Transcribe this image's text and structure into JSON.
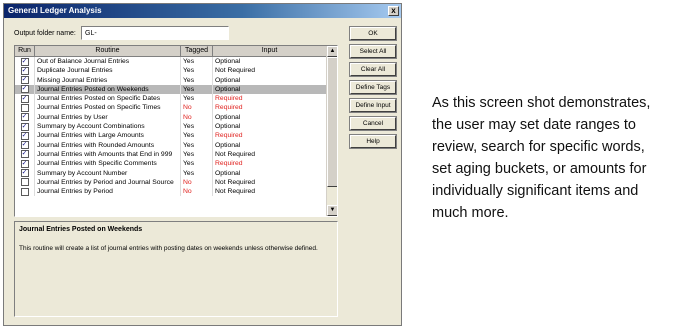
{
  "window": {
    "title": "General Ledger Analysis",
    "close_glyph": "x"
  },
  "output": {
    "label": "Output folder name:",
    "value": "GL-"
  },
  "grid": {
    "columns": [
      "Run",
      "Routine",
      "Tagged",
      "Input"
    ],
    "rows": [
      {
        "run": true,
        "routine": "Out of Balance Journal Entries",
        "tagged": "Yes",
        "input": "Optional",
        "tagged_red": false,
        "input_red": false
      },
      {
        "run": true,
        "routine": "Duplicate Journal Entries",
        "tagged": "Yes",
        "input": "Not Required",
        "tagged_red": false,
        "input_red": false
      },
      {
        "run": true,
        "routine": "Missing Journal Entries",
        "tagged": "Yes",
        "input": "Optional",
        "tagged_red": false,
        "input_red": false
      },
      {
        "run": true,
        "routine": "Journal Entries Posted on Weekends",
        "tagged": "Yes",
        "input": "Optional",
        "tagged_red": false,
        "input_red": false,
        "selected": true
      },
      {
        "run": true,
        "routine": "Journal Entries Posted on Specific Dates",
        "tagged": "Yes",
        "input": "Required",
        "tagged_red": false,
        "input_red": true
      },
      {
        "run": false,
        "routine": "Journal Entries Posted on Specific Times",
        "tagged": "No",
        "input": "Required",
        "tagged_red": true,
        "input_red": true
      },
      {
        "run": true,
        "routine": "Journal Entries by User",
        "tagged": "No",
        "input": "Optional",
        "tagged_red": true,
        "input_red": false
      },
      {
        "run": true,
        "routine": "Summary by Account Combinations",
        "tagged": "Yes",
        "input": "Optional",
        "tagged_red": false,
        "input_red": false
      },
      {
        "run": true,
        "routine": "Journal Entries with Large Amounts",
        "tagged": "Yes",
        "input": "Required",
        "tagged_red": false,
        "input_red": true
      },
      {
        "run": true,
        "routine": "Journal Entries with Rounded Amounts",
        "tagged": "Yes",
        "input": "Optional",
        "tagged_red": false,
        "input_red": false
      },
      {
        "run": true,
        "routine": "Journal Entries with Amounts that End in 999",
        "tagged": "Yes",
        "input": "Not Required",
        "tagged_red": false,
        "input_red": false
      },
      {
        "run": true,
        "routine": "Journal Entries with Specific Comments",
        "tagged": "Yes",
        "input": "Required",
        "tagged_red": false,
        "input_red": true
      },
      {
        "run": true,
        "routine": "Summary by Account Number",
        "tagged": "Yes",
        "input": "Optional",
        "tagged_red": false,
        "input_red": false
      },
      {
        "run": false,
        "routine": "Journal Entries by Period and Journal Source",
        "tagged": "No",
        "input": "Not Required",
        "tagged_red": true,
        "input_red": false
      },
      {
        "run": false,
        "routine": "Journal Entries by Period",
        "tagged": "No",
        "input": "Not Required",
        "tagged_red": true,
        "input_red": false
      }
    ],
    "check_glyph": "✓"
  },
  "description": {
    "title": "Journal Entries Posted on Weekends",
    "text": "This routine will create a list of journal entries with posting dates on weekends unless otherwise defined."
  },
  "buttons": {
    "ok": "OK",
    "select_all": "Select All",
    "clear_all": "Clear All",
    "define_tags": "Define Tags",
    "define_input": "Define Input",
    "cancel": "Cancel",
    "help": "Help"
  },
  "caption": "As this screen shot demonstrates, the user may set date ranges to review, search for specific words, set aging buckets, or amounts for individually significant items and much more.",
  "colors": {
    "required_text": "#e0221f",
    "selected_row": "#b8b8b8",
    "titlebar": "#0a246a"
  },
  "icons": {
    "close": "close-icon",
    "scroll_up": "scroll-up-arrow-icon",
    "scroll_down": "scroll-down-arrow-icon",
    "check": "checkmark-icon"
  }
}
